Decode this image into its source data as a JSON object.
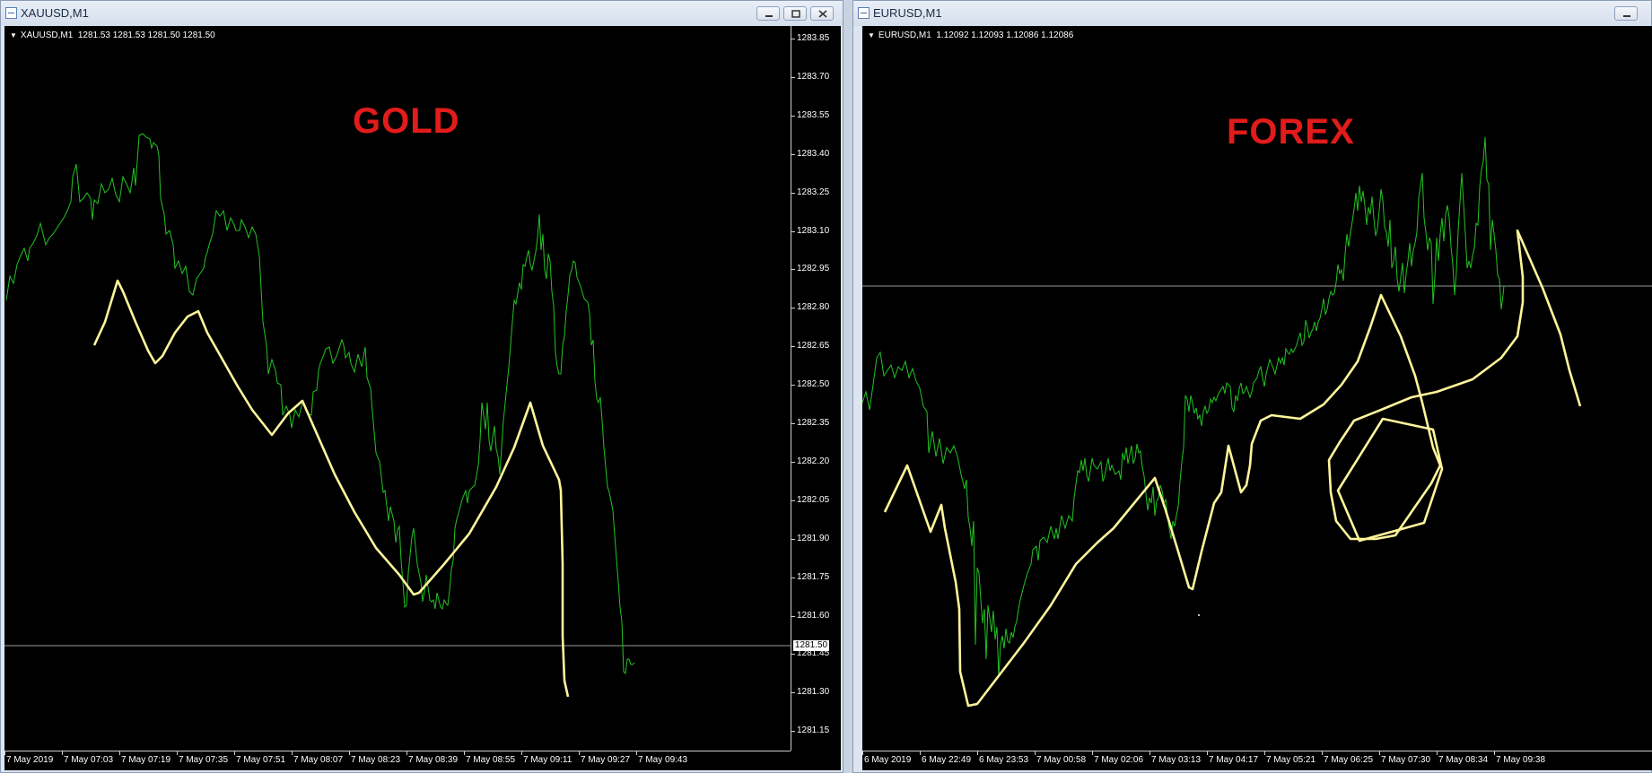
{
  "left_window": {
    "title": "XAUUSD,M1",
    "info_line": "XAUUSD,M1  1281.53 1281.53 1281.50 1281.50",
    "headline": "GOLD",
    "y_labels": [
      "1283.85",
      "1283.70",
      "1283.55",
      "1283.40",
      "1283.25",
      "1283.10",
      "1282.95",
      "1282.80",
      "1282.65",
      "1282.50",
      "1282.35",
      "1282.20",
      "1282.05",
      "1281.90",
      "1281.75",
      "1281.60",
      "1281.45",
      "1281.30",
      "1281.15"
    ],
    "price_tag": "1281.50",
    "x_labels": [
      "7 May 2019",
      "7 May 07:03",
      "7 May 07:19",
      "7 May 07:35",
      "7 May 07:51",
      "7 May 08:07",
      "7 May 08:23",
      "7 May 08:39",
      "7 May 08:55",
      "7 May 09:11",
      "7 May 09:27",
      "7 May 09:43"
    ]
  },
  "right_window": {
    "title": "EURUSD,M1",
    "info_line": "EURUSD,M1  1.12092 1.12093 1.12086 1.12086",
    "headline": "FOREX",
    "x_labels": [
      "6 May 2019",
      "6 May 22:49",
      "6 May 23:53",
      "7 May 00:58",
      "7 May 02:06",
      "7 May 03:13",
      "7 May 04:17",
      "7 May 05:21",
      "7 May 06:25",
      "7 May 07:30",
      "7 May 08:34",
      "7 May 09:38"
    ]
  },
  "colors": {
    "price_line": "#22c322",
    "drawing": "#fff59a",
    "headline": "#e21b1b",
    "background": "#000000"
  },
  "icons": [
    "chart-window-icon",
    "minimize-icon",
    "maximize-icon",
    "close-icon",
    "dropdown-triangle-icon"
  ]
}
